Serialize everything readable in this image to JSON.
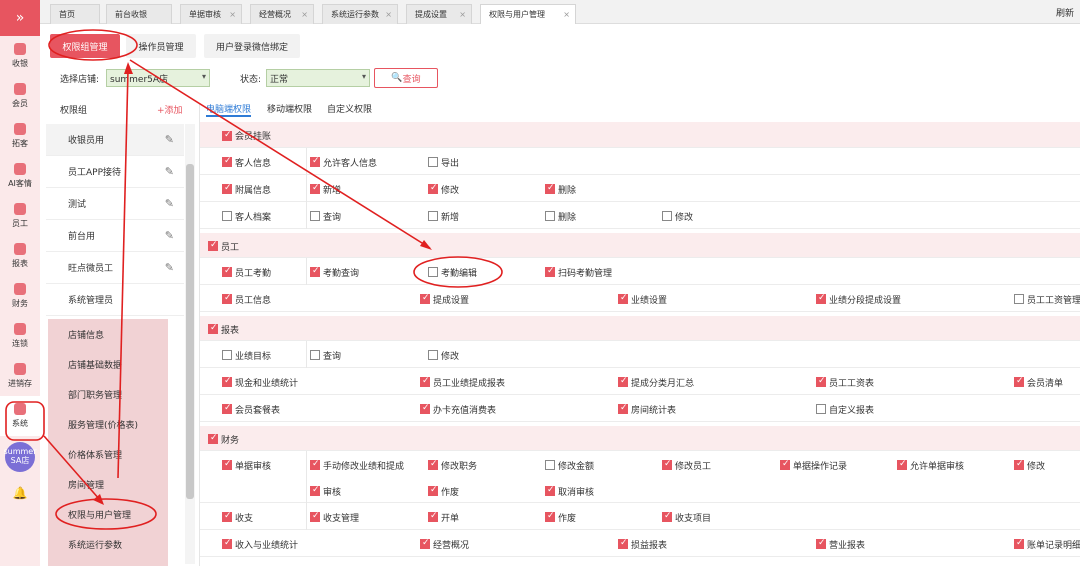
{
  "rail": {
    "expand_icon": "»",
    "items": [
      {
        "label": "收银",
        "icon": "cash-icon"
      },
      {
        "label": "会员",
        "icon": "member-icon"
      },
      {
        "label": "拓客",
        "icon": "expand-customer-icon"
      },
      {
        "label": "AI客情",
        "icon": "ai-icon"
      },
      {
        "label": "员工",
        "icon": "staff-icon"
      },
      {
        "label": "报表",
        "icon": "report-icon"
      },
      {
        "label": "财务",
        "icon": "finance-icon"
      },
      {
        "label": "连锁",
        "icon": "chain-icon"
      },
      {
        "label": "进销存",
        "icon": "inventory-icon"
      },
      {
        "label": "系统",
        "icon": "gear-icon"
      }
    ],
    "store": "summer SA店"
  },
  "tabs": [
    {
      "label": "首页"
    },
    {
      "label": "前台收银"
    },
    {
      "label": "单据审核"
    },
    {
      "label": "经营概况"
    },
    {
      "label": "系统运行参数"
    },
    {
      "label": "提成设置"
    },
    {
      "label": "权限与用户管理"
    }
  ],
  "refresh_label": "刷新",
  "subtabs": [
    "权限组管理",
    "操作员管理",
    "用户登录微信绑定"
  ],
  "filters": {
    "store_label": "选择店铺:",
    "store_value": "summer5A店",
    "status_label": "状态:",
    "status_value": "正常",
    "query_label": "查询"
  },
  "groups": {
    "title": "权限组",
    "add_label": "+添加",
    "items": [
      "收银员用",
      "员工APP接待",
      "测试",
      "前台用",
      "旺点微员工",
      "系统管理员"
    ]
  },
  "system_menu": [
    "店铺信息",
    "店铺基础数据",
    "部门职务管理",
    "服务管理(价格表)",
    "价格体系管理",
    "房间管理",
    "权限与用户管理",
    "系统运行参数"
  ],
  "perm_tabs": [
    "电脑端权限",
    "移动端权限",
    "自定义权限"
  ],
  "permissions": {
    "member_section": "会员挂账",
    "rows": {
      "r1": [
        [
          "客人信息",
          true
        ],
        [
          "允许客人信息",
          true
        ],
        [
          "导出",
          false
        ]
      ],
      "r2": [
        [
          "附属信息",
          true
        ],
        [
          "新增",
          true
        ],
        [
          "修改",
          true
        ],
        [
          "删除",
          true
        ]
      ],
      "r3": [
        [
          "客人档案",
          false
        ],
        [
          "查询",
          false
        ],
        [
          "新增",
          false
        ],
        [
          "删除",
          false
        ],
        [
          "修改",
          false
        ]
      ],
      "s_staff": "员工",
      "r4": [
        [
          "员工考勤",
          true
        ],
        [
          "考勤查询",
          true
        ],
        [
          "考勤编辑",
          false
        ],
        [
          "扫码考勤管理",
          true
        ]
      ],
      "r5": [
        [
          "员工信息",
          true
        ],
        [
          "提成设置",
          true
        ],
        [
          "业绩设置",
          true
        ],
        [
          "业绩分段提成设置",
          true
        ],
        [
          "员工工资管理",
          false
        ]
      ],
      "s_report": "报表",
      "r6": [
        [
          "业绩目标",
          false
        ],
        [
          "查询",
          false
        ],
        [
          "修改",
          false
        ]
      ],
      "r7": [
        [
          "现金和业绩统计",
          true
        ],
        [
          "员工业绩提成报表",
          true
        ],
        [
          "提成分类月汇总",
          true
        ],
        [
          "员工工资表",
          true
        ],
        [
          "会员清单",
          true
        ]
      ],
      "r8": [
        [
          "会员套餐表",
          true
        ],
        [
          "办卡充值消费表",
          true
        ],
        [
          "房间统计表",
          true
        ],
        [
          "自定义报表",
          false
        ]
      ],
      "s_finance": "财务",
      "r9a": [
        [
          "单据审核",
          true
        ],
        [
          "手动修改业绩和提成",
          true
        ],
        [
          "修改职务",
          true
        ],
        [
          "修改金额",
          false
        ],
        [
          "修改员工",
          true
        ],
        [
          "单据操作记录",
          true
        ],
        [
          "允许单据审核",
          true
        ],
        [
          "修改",
          true
        ]
      ],
      "r9b": [
        [
          "审核",
          true
        ],
        [
          "作废",
          true
        ],
        [
          "取消审核",
          true
        ]
      ],
      "r10": [
        [
          "收支",
          true
        ],
        [
          "收支管理",
          true
        ],
        [
          "开单",
          true
        ],
        [
          "作废",
          true
        ],
        [
          "收支项目",
          true
        ]
      ],
      "r11": [
        [
          "收入与业绩统计",
          true
        ],
        [
          "经营概况",
          true
        ],
        [
          "损益报表",
          true
        ],
        [
          "营业报表",
          true
        ],
        [
          "账单记录明细",
          true
        ]
      ]
    }
  },
  "colors": {
    "accent": "#e75560",
    "rail_bg": "#fbe9ea",
    "section_bg": "#fbeced",
    "link_blue": "#2e7bd6"
  }
}
